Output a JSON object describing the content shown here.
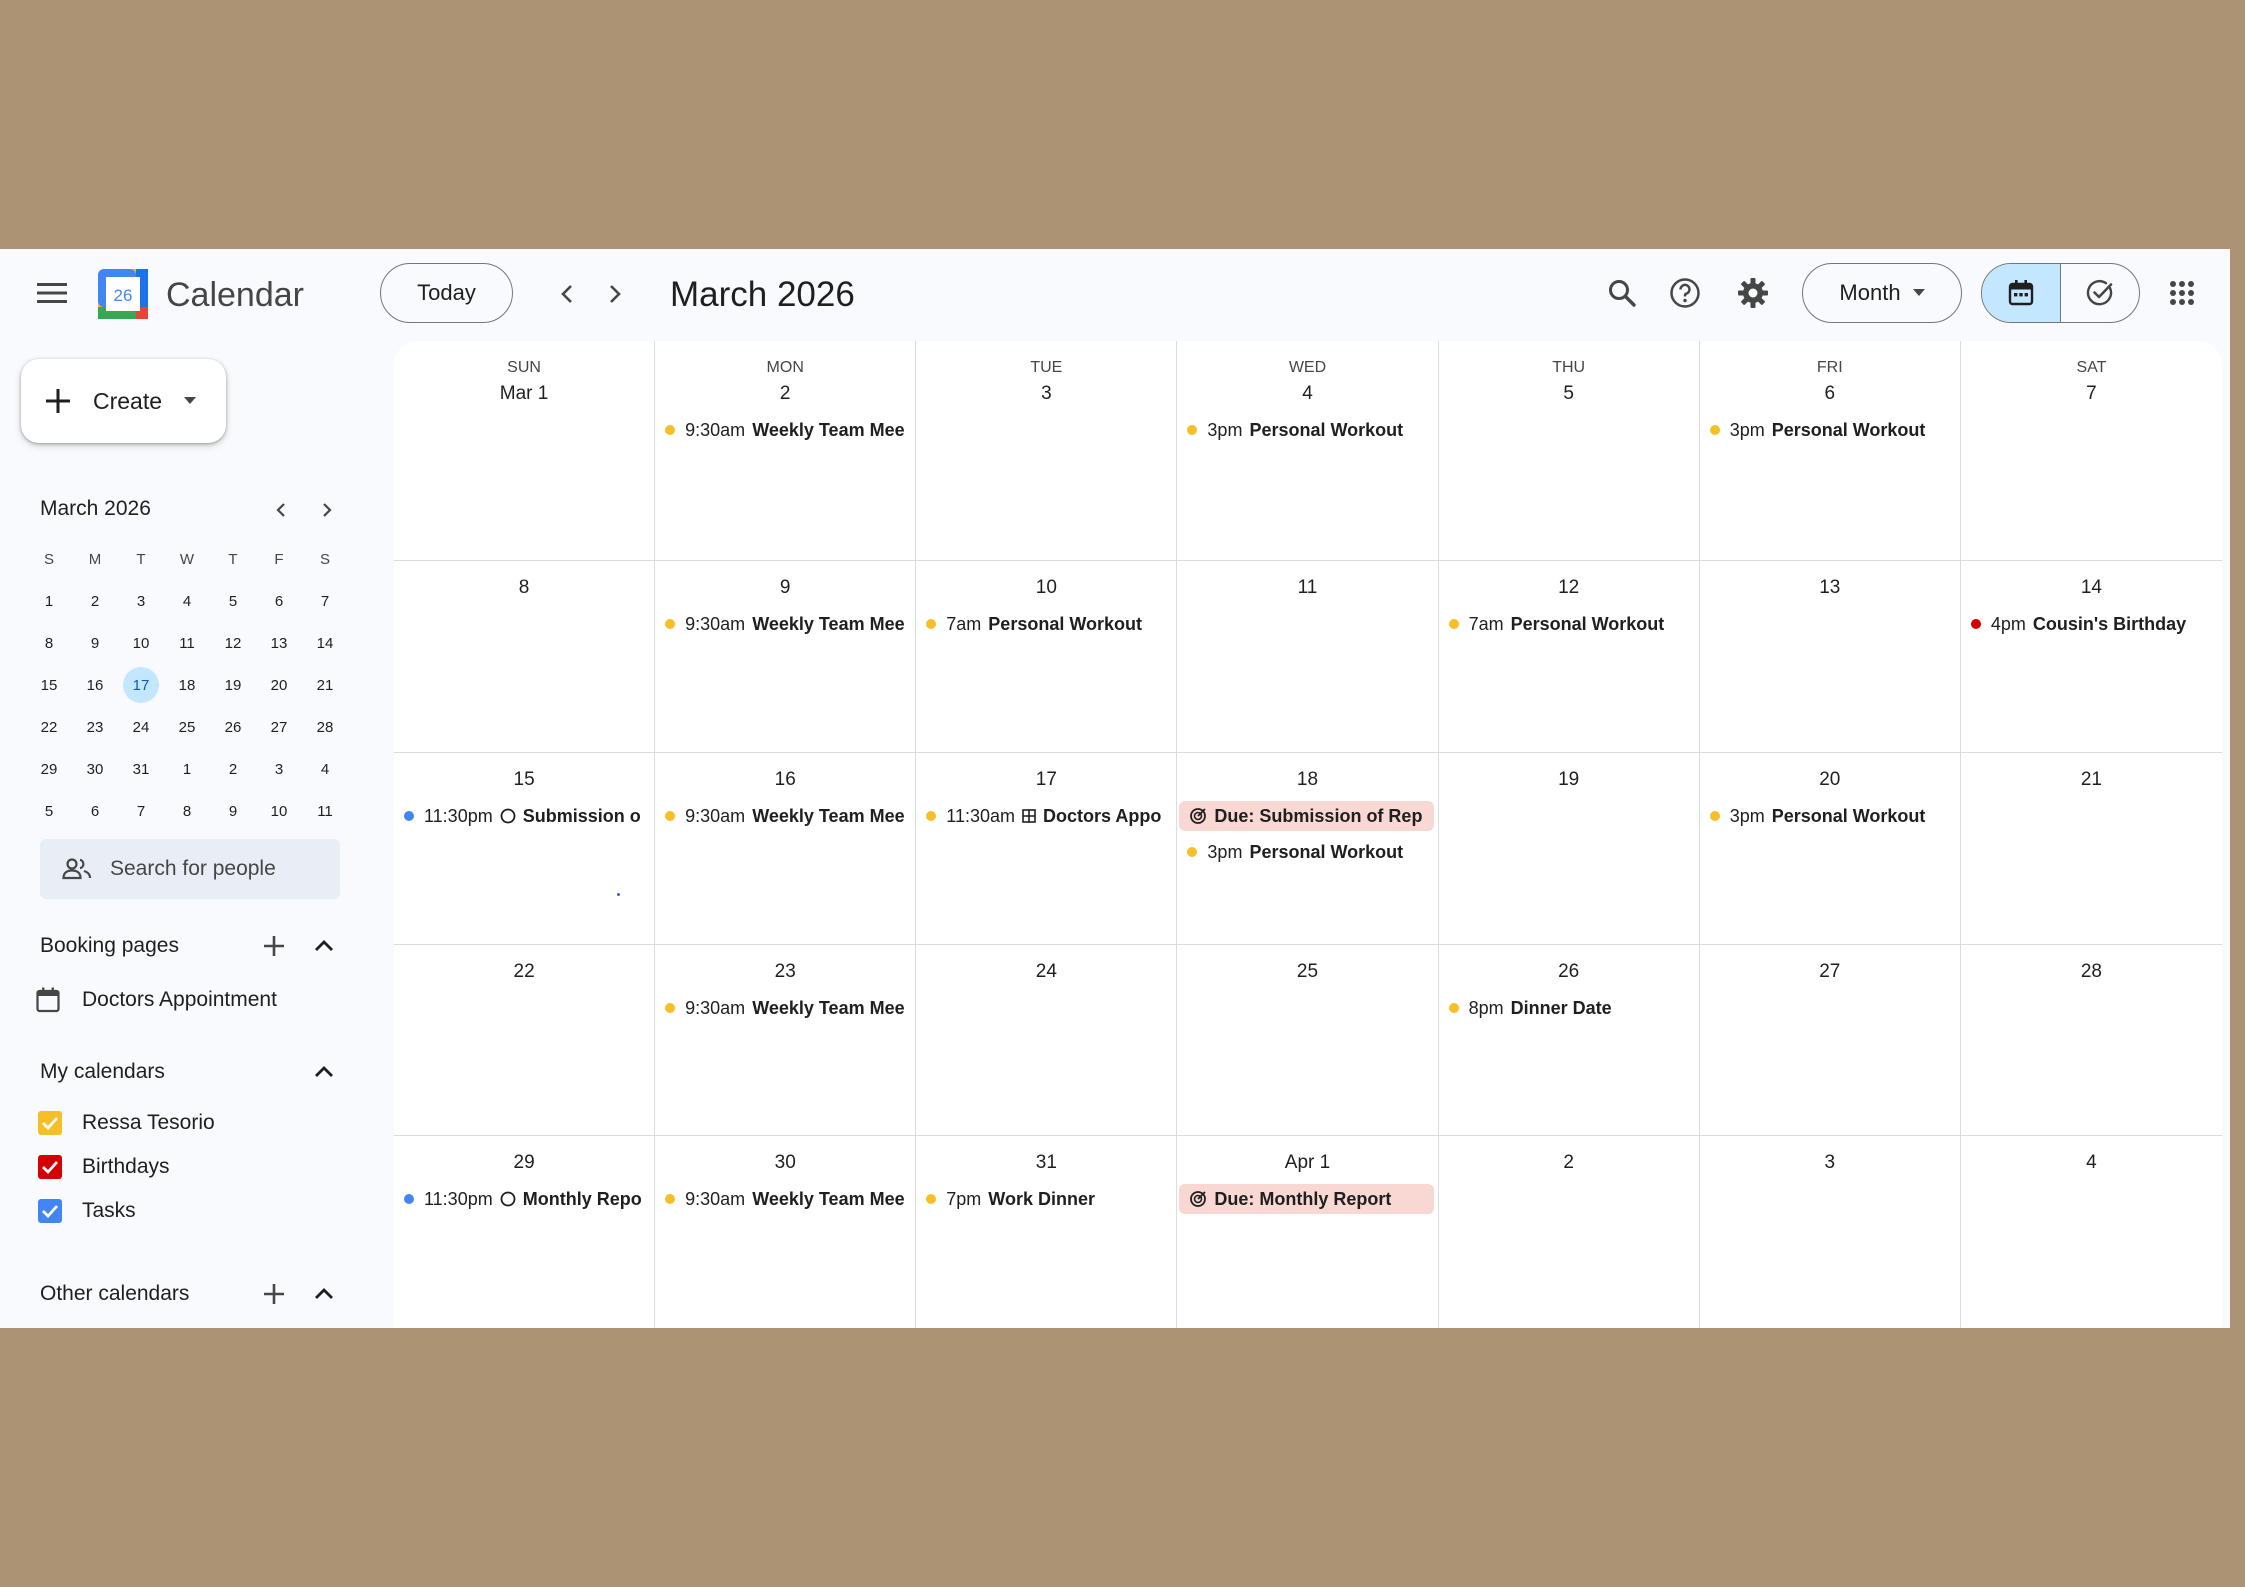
{
  "header": {
    "app_title": "Calendar",
    "logo_day": "26",
    "today_label": "Today",
    "month_title": "March 2026",
    "view_label": "Month"
  },
  "colors": {
    "accent": "#0b57d0",
    "selected": "#c2e7ff",
    "event_yellow": "#f6bf26",
    "event_blue": "#4285f4",
    "event_red": "#d50000",
    "task_bg": "#f9d7d2"
  },
  "sidebar": {
    "create_label": "Create",
    "mini_cal": {
      "title": "March 2026",
      "dow": [
        "S",
        "M",
        "T",
        "W",
        "T",
        "F",
        "S"
      ],
      "weeks": [
        [
          "1",
          "2",
          "3",
          "4",
          "5",
          "6",
          "7"
        ],
        [
          "8",
          "9",
          "10",
          "11",
          "12",
          "13",
          "14"
        ],
        [
          "15",
          "16",
          "17",
          "18",
          "19",
          "20",
          "21"
        ],
        [
          "22",
          "23",
          "24",
          "25",
          "26",
          "27",
          "28"
        ],
        [
          "29",
          "30",
          "31",
          "1",
          "2",
          "3",
          "4"
        ],
        [
          "5",
          "6",
          "7",
          "8",
          "9",
          "10",
          "11"
        ]
      ],
      "selected": "17"
    },
    "people_search_placeholder": "Search for people",
    "booking": {
      "title": "Booking pages",
      "items": [
        "Doctors Appointment"
      ]
    },
    "my_calendars": {
      "title": "My calendars",
      "items": [
        {
          "label": "Ressa Tesorio",
          "color": "#f6bf26"
        },
        {
          "label": "Birthdays",
          "color": "#d50000"
        },
        {
          "label": "Tasks",
          "color": "#4285f4"
        }
      ]
    },
    "other_calendars": {
      "title": "Other calendars"
    }
  },
  "month": {
    "dow": [
      "SUN",
      "MON",
      "TUE",
      "WED",
      "THU",
      "FRI",
      "SAT"
    ],
    "weeks": [
      [
        {
          "date": "Mar 1",
          "events": []
        },
        {
          "date": "2",
          "events": [
            {
              "time": "9:30am",
              "title": "Weekly Team Mee",
              "color": "#f6bf26"
            }
          ]
        },
        {
          "date": "3",
          "events": []
        },
        {
          "date": "4",
          "events": [
            {
              "time": "3pm",
              "title": "Personal Workout",
              "color": "#f6bf26"
            }
          ]
        },
        {
          "date": "5",
          "events": []
        },
        {
          "date": "6",
          "events": [
            {
              "time": "3pm",
              "title": "Personal Workout",
              "color": "#f6bf26"
            }
          ]
        },
        {
          "date": "7",
          "events": []
        }
      ],
      [
        {
          "date": "8",
          "events": []
        },
        {
          "date": "9",
          "events": [
            {
              "time": "9:30am",
              "title": "Weekly Team Mee",
              "color": "#f6bf26"
            }
          ]
        },
        {
          "date": "10",
          "events": [
            {
              "time": "7am",
              "title": "Personal Workout",
              "color": "#f6bf26"
            }
          ]
        },
        {
          "date": "11",
          "events": []
        },
        {
          "date": "12",
          "events": [
            {
              "time": "7am",
              "title": "Personal Workout",
              "color": "#f6bf26"
            }
          ]
        },
        {
          "date": "13",
          "events": []
        },
        {
          "date": "14",
          "events": [
            {
              "time": "4pm",
              "title": "Cousin's Birthday",
              "color": "#d50000"
            }
          ]
        }
      ],
      [
        {
          "date": "15",
          "events": [
            {
              "time": "11:30pm",
              "title": "Submission o",
              "color": "#4285f4",
              "icon": "circle-icon"
            }
          ]
        },
        {
          "date": "16",
          "events": [
            {
              "time": "9:30am",
              "title": "Weekly Team Mee",
              "color": "#f6bf26"
            }
          ]
        },
        {
          "date": "17",
          "events": [
            {
              "time": "11:30am",
              "title": "Doctors Appo",
              "color": "#f6bf26",
              "icon": "booking-grid-icon"
            }
          ]
        },
        {
          "date": "18",
          "events": [
            {
              "task": true,
              "title": "Due: Submission of Rep"
            },
            {
              "time": "3pm",
              "title": "Personal Workout",
              "color": "#f6bf26"
            }
          ]
        },
        {
          "date": "19",
          "events": []
        },
        {
          "date": "20",
          "events": [
            {
              "time": "3pm",
              "title": "Personal Workout",
              "color": "#f6bf26"
            }
          ]
        },
        {
          "date": "21",
          "events": []
        }
      ],
      [
        {
          "date": "22",
          "events": []
        },
        {
          "date": "23",
          "events": [
            {
              "time": "9:30am",
              "title": "Weekly Team Mee",
              "color": "#f6bf26"
            }
          ]
        },
        {
          "date": "24",
          "events": []
        },
        {
          "date": "25",
          "events": []
        },
        {
          "date": "26",
          "events": [
            {
              "time": "8pm",
              "title": "Dinner Date",
              "color": "#f6bf26"
            }
          ]
        },
        {
          "date": "27",
          "events": []
        },
        {
          "date": "28",
          "events": []
        }
      ],
      [
        {
          "date": "29",
          "events": [
            {
              "time": "11:30pm",
              "title": "Monthly Repo",
              "color": "#4285f4",
              "icon": "circle-icon"
            }
          ]
        },
        {
          "date": "30",
          "events": [
            {
              "time": "9:30am",
              "title": "Weekly Team Mee",
              "color": "#f6bf26"
            }
          ]
        },
        {
          "date": "31",
          "events": [
            {
              "time": "7pm",
              "title": "Work Dinner",
              "color": "#f6bf26"
            }
          ]
        },
        {
          "date": "Apr 1",
          "events": [
            {
              "task": true,
              "title": "Due: Monthly Report"
            }
          ]
        },
        {
          "date": "2",
          "events": []
        },
        {
          "date": "3",
          "events": []
        },
        {
          "date": "4",
          "events": []
        }
      ]
    ]
  }
}
